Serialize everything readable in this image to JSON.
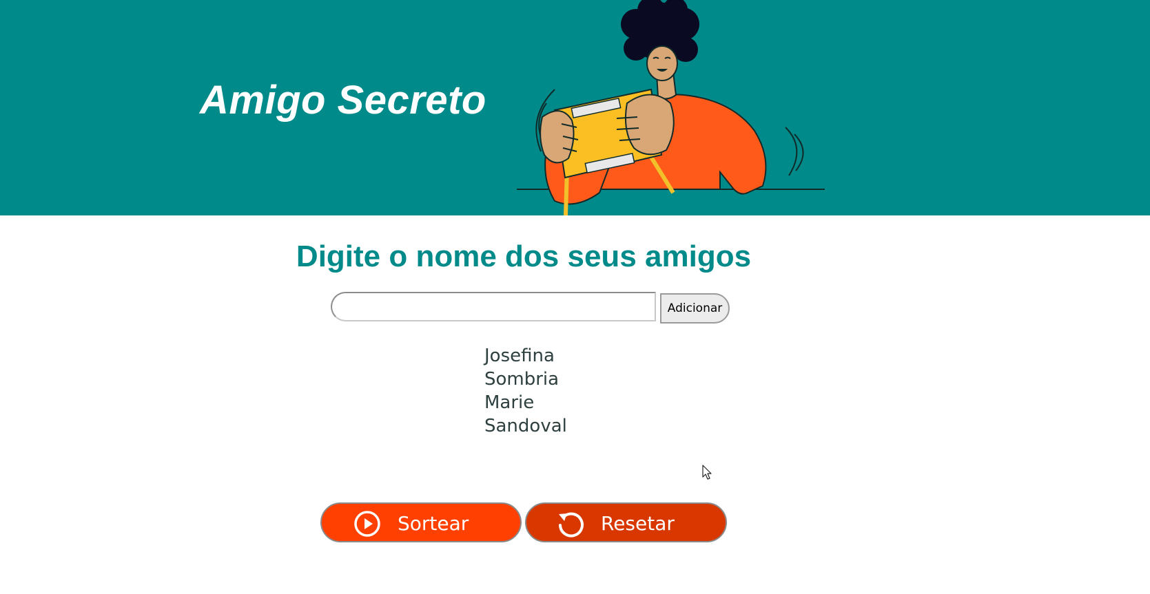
{
  "header": {
    "title": "Amigo Secreto",
    "background_color": "#008a8a",
    "illustration": "person-holding-game-console-illustration"
  },
  "main": {
    "title": "Digite o nome dos seus amigos",
    "title_color": "#008a8a",
    "name_input": {
      "value": "",
      "placeholder": ""
    },
    "add_button_label": "Adicionar",
    "friends": [
      "Josefina",
      "Sombria",
      "Marie",
      "Sandoval"
    ]
  },
  "actions": {
    "draw": {
      "label": "Sortear",
      "icon": "play-circle-icon",
      "color": "#ff4000"
    },
    "reset": {
      "label": "Resetar",
      "icon": "reset-arrow-icon",
      "color": "#d83800"
    }
  }
}
